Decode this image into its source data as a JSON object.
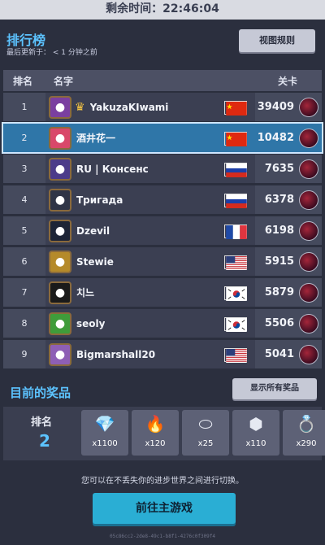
{
  "timer": {
    "label": "剩余时间：",
    "value": "22:46:04"
  },
  "leaderboard": {
    "title": "排行榜",
    "updated": "最后更新于：  < 1 分钟之前",
    "rules_button": "视图规则",
    "columns": {
      "rank": "排名",
      "name": "名字",
      "level": "关卡"
    },
    "rows": [
      {
        "rank": "1",
        "name": "YakuzaKIwami",
        "crown": true,
        "flag": "china",
        "level": "39409",
        "avatar_color": "#7a3fa0",
        "avatar_icon": "skull-avatar-icon"
      },
      {
        "rank": "2",
        "name": "酒井花一",
        "crown": false,
        "flag": "china",
        "level": "10482",
        "avatar_color": "#d9486a",
        "avatar_icon": "anime-girl-avatar-icon",
        "highlight": true
      },
      {
        "rank": "3",
        "name": "RU | Консенс",
        "crown": false,
        "flag": "russia",
        "level": "7635",
        "avatar_color": "#4c3c8a",
        "avatar_icon": "wolf-avatar-icon"
      },
      {
        "rank": "4",
        "name": "Тригада",
        "crown": false,
        "flag": "russia",
        "level": "6378",
        "avatar_color": "#2f3446",
        "avatar_icon": "feather-avatar-icon"
      },
      {
        "rank": "5",
        "name": "Dzevil",
        "crown": false,
        "flag": "france",
        "level": "6198",
        "avatar_color": "#1d2436",
        "avatar_icon": "hooded-avatar-icon"
      },
      {
        "rank": "6",
        "name": "Stewie",
        "crown": false,
        "flag": "usa",
        "level": "5915",
        "avatar_color": "#b58a2a",
        "avatar_icon": "coin-avatar-icon"
      },
      {
        "rank": "7",
        "name": "치느",
        "crown": false,
        "flag": "korea",
        "level": "5879",
        "avatar_color": "#1a1a1a",
        "avatar_icon": "black-cat-avatar-icon"
      },
      {
        "rank": "8",
        "name": "seoly",
        "crown": false,
        "flag": "korea",
        "level": "5506",
        "avatar_color": "#3f9c3a",
        "avatar_icon": "green-monster-avatar-icon"
      },
      {
        "rank": "9",
        "name": "Bigmarshall20",
        "crown": false,
        "flag": "usa",
        "level": "5041",
        "avatar_color": "#8e5fb5",
        "avatar_icon": "purple-hair-avatar-icon"
      }
    ]
  },
  "prizes": {
    "title": "目前的奖品",
    "show_all_button": "显示所有奖品",
    "rank_label": "排名",
    "rank_value": "2",
    "items": [
      {
        "icon": "diamonds-icon",
        "glyph": "💎",
        "amount": "x1100"
      },
      {
        "icon": "fire-gem-icon",
        "glyph": "🔥",
        "amount": "x120"
      },
      {
        "icon": "silver-stone-icon",
        "glyph": "⬭",
        "amount": "x25"
      },
      {
        "icon": "gold-badge-icon",
        "glyph": "⬢",
        "amount": "x110"
      },
      {
        "icon": "ring-icon",
        "glyph": "💍",
        "amount": "x290"
      }
    ]
  },
  "footer": {
    "switch_text": "您可以在不丢失你的进步世界之间进行切换。",
    "main_game_button": "前往主游戏",
    "session_id": "05c86cc2-2de8-49c1-b8f1-4276c0f309f4"
  },
  "colors": {
    "accent_blue": "#5cc3ff",
    "highlight_row": "#2f76a8",
    "button_cyan": "#2aaed4"
  }
}
